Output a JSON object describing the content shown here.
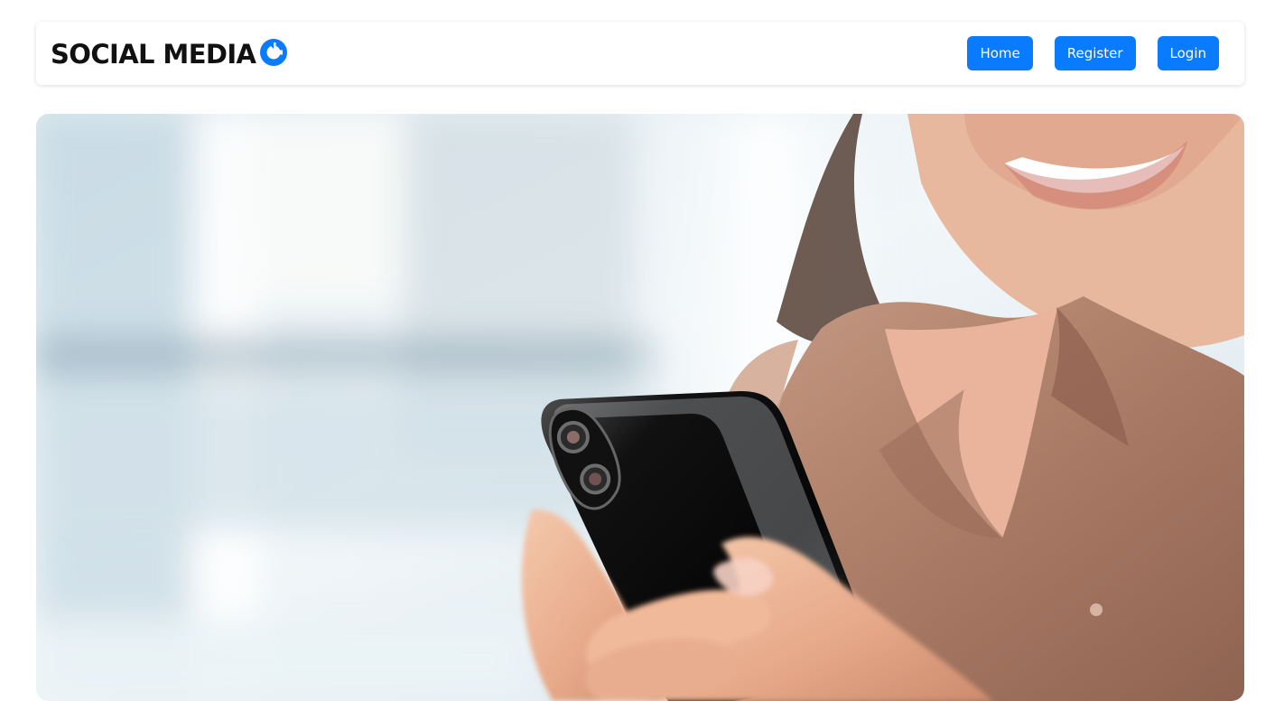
{
  "navbar": {
    "brand": "SOCIAL MEDIA",
    "brand_icon": "social-media-logo-icon",
    "items": [
      {
        "label": "Home"
      },
      {
        "label": "Register"
      },
      {
        "label": "Login"
      }
    ]
  },
  "hero": {
    "image": "woman-using-smartphone-photo"
  },
  "colors": {
    "accent": "#087bff",
    "text": "#111111",
    "background": "#ffffff"
  }
}
